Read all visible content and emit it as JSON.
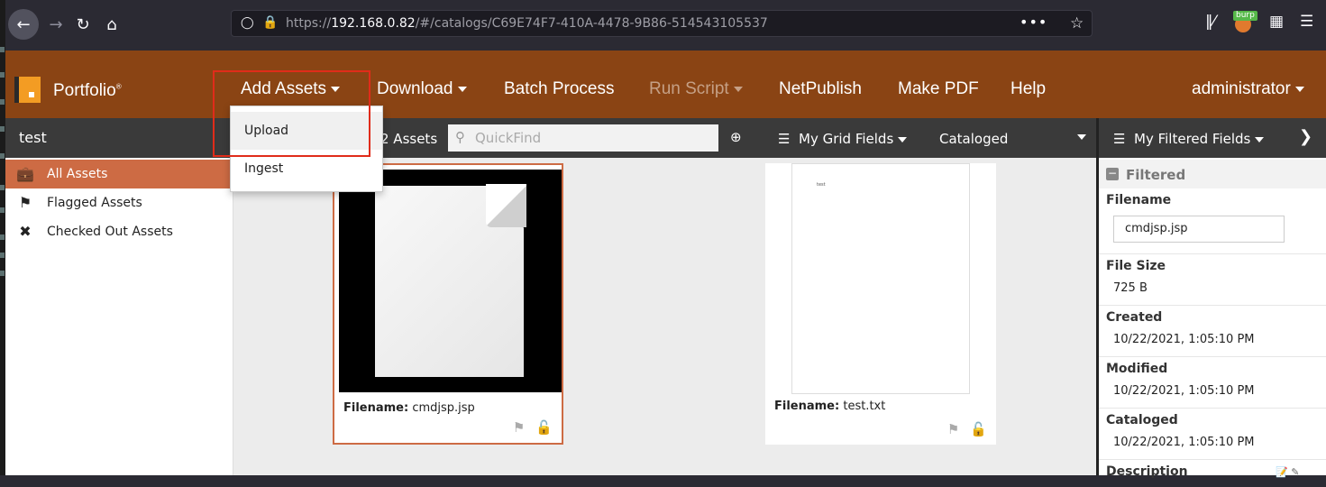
{
  "browser": {
    "url_prefix": "https://",
    "url_host": "192.168.0.82",
    "url_path": "/#/catalogs/C69E74F7-410A-4478-9B86-514543105537",
    "burp_label": "burp"
  },
  "app": {
    "brand": "Portfolio",
    "brand_mark": "®",
    "menu": {
      "add_assets": "Add Assets",
      "download": "Download",
      "batch_process": "Batch Process",
      "run_script": "Run Script",
      "netpublish": "NetPublish",
      "make_pdf": "Make PDF",
      "help": "Help",
      "user": "administrator"
    },
    "add_assets_dropdown": [
      "Upload",
      "Ingest"
    ]
  },
  "subbar": {
    "catalog": "test",
    "asset_count": "2 Assets",
    "quickfind_placeholder": "QuickFind",
    "grid_fields": "My Grid Fields",
    "sort": "Cataloged"
  },
  "sidebar": {
    "items": [
      {
        "label": "All Assets",
        "icon": "briefcase-icon"
      },
      {
        "label": "Flagged Assets",
        "icon": "flag-icon"
      },
      {
        "label": "Checked Out Assets",
        "icon": "tag-icon"
      }
    ]
  },
  "assets": [
    {
      "label": "Filename:",
      "value": "cmdjsp.jsp",
      "thumb_text": ""
    },
    {
      "label": "Filename:",
      "value": "test.txt",
      "thumb_text": "test"
    }
  ],
  "panel": {
    "title": "My Filtered Fields",
    "section": "Filtered",
    "fields": {
      "filename_label": "Filename",
      "filename_value": "cmdjsp.jsp",
      "filesize_label": "File Size",
      "filesize_value": "725 B",
      "created_label": "Created",
      "created_value": "10/22/2021, 1:05:10 PM",
      "modified_label": "Modified",
      "modified_value": "10/22/2021, 1:05:10 PM",
      "cataloged_label": "Cataloged",
      "cataloged_value": "10/22/2021, 1:05:10 PM",
      "description_label": "Description"
    }
  },
  "colors": {
    "header": "#8a4414",
    "accent": "#cd6b44",
    "highlight_box": "#e02c1a"
  }
}
